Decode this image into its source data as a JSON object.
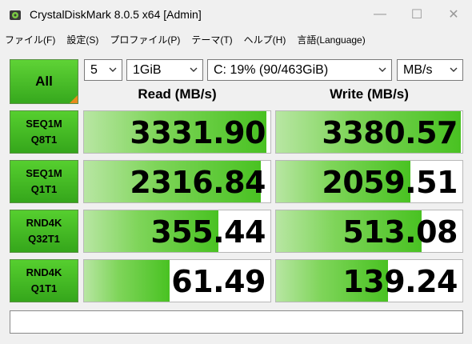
{
  "window": {
    "title": "CrystalDiskMark 8.0.5 x64 [Admin]",
    "minimize_glyph": "—",
    "maximize_glyph": "☐",
    "close_glyph": "✕",
    "icon": "disk-app-icon"
  },
  "menu": {
    "items": [
      "ファイル(F)",
      "設定(S)",
      "プロファイル(P)",
      "テーマ(T)",
      "ヘルプ(H)",
      "言語(Language)"
    ]
  },
  "toolbar": {
    "all_label": "All",
    "count_value": "5",
    "size_value": "1GiB",
    "drive_value": "C: 19% (90/463GiB)",
    "unit_value": "MB/s"
  },
  "headers": {
    "read": "Read (MB/s)",
    "write": "Write (MB/s)"
  },
  "rows": [
    {
      "line1": "SEQ1M",
      "line2": "Q8T1",
      "read": "3331.90",
      "write": "3380.57",
      "read_fill": 0.98,
      "write_fill": 0.99
    },
    {
      "line1": "SEQ1M",
      "line2": "Q1T1",
      "read": "2316.84",
      "write": "2059.51",
      "read_fill": 0.95,
      "write_fill": 0.72
    },
    {
      "line1": "RND4K",
      "line2": "Q32T1",
      "read": "355.44",
      "write": "513.08",
      "read_fill": 0.72,
      "write_fill": 0.78
    },
    {
      "line1": "RND4K",
      "line2": "Q1T1",
      "read": "61.49",
      "write": "139.24",
      "read_fill": 0.46,
      "write_fill": 0.6
    }
  ],
  "comment": "",
  "colors": {
    "accent_green": "#49c222",
    "all_corner": "#e88a1a"
  }
}
